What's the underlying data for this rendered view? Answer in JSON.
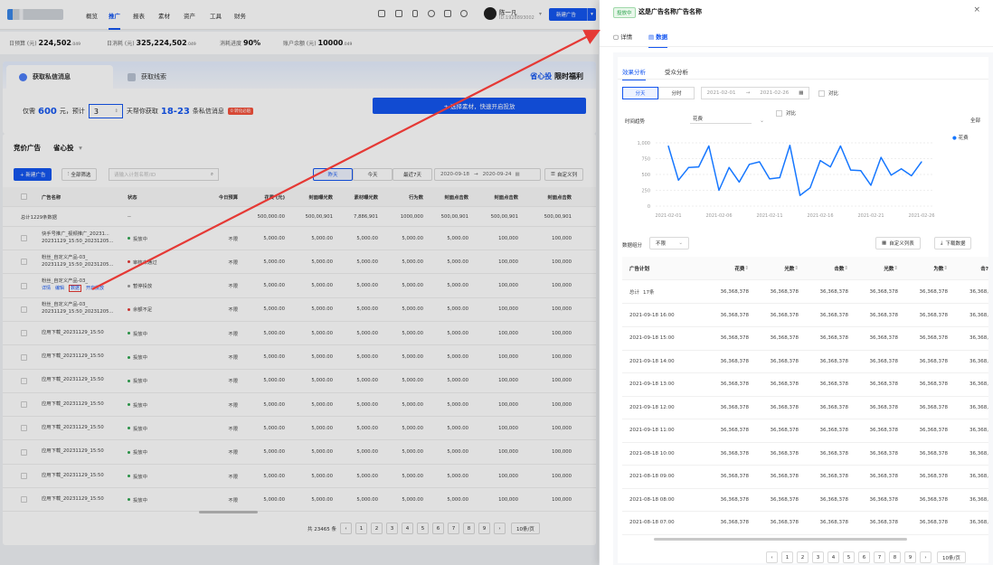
{
  "nav": {
    "items": [
      "概览",
      "推广",
      "报表",
      "素材",
      "资产",
      "工具",
      "财务"
    ],
    "active_index": 1,
    "user_name": "陈一凡",
    "user_id": "ID:1928893002",
    "new_ad_button": "新建广告"
  },
  "budget": {
    "daily_label": "日预算 (元)",
    "daily_value": "224,502",
    "daily_dec": ".049",
    "spend_label": "日消耗 (元)",
    "spend_value": "325,224,502",
    "spend_dec": ".049",
    "progress_label": "消耗进度",
    "progress_value": "90%",
    "balance_label": "账户余额 (元)",
    "balance_value": "10000",
    "balance_dec": ".049"
  },
  "promo": {
    "tab1": "获取私信消息",
    "tab2": "获取线索",
    "brand": "省心投",
    "brand_suffix": "限时福利",
    "line_prefix": "仅需",
    "price": "600",
    "line_mid": "元，预计",
    "days": "3",
    "line_mid2": "天帮你获取",
    "range": "18-23",
    "line_suffix": "条私信消息",
    "tag": "0 转化必赔",
    "cta": "+ 选择素材，快速开启投放"
  },
  "ads": {
    "title": "竞价广告",
    "mode": "省心投",
    "new_button": "+ 新建广告",
    "filter_button": "全部筛选",
    "search_placeholder": "请输入计划名称/ID",
    "seg": [
      "昨天",
      "今天",
      "最近7天"
    ],
    "seg_active": 0,
    "date_from": "2020-09-18",
    "date_to": "2020-09-24",
    "custom_cols": "自定义列",
    "columns": [
      "广告名称",
      "状态",
      "今日预算",
      "花费 (元)",
      "封面曝光数",
      "素材曝光数",
      "行为数",
      "封面点击数",
      "封面点击数",
      "封面点击数"
    ],
    "total_row": {
      "name": "总计1229条数据",
      "status": "--",
      "values": [
        "500,000.00",
        "500,00,901",
        "7,886,901",
        "1000,000",
        "500,00,901",
        "500,00,901",
        "500,00,901"
      ]
    },
    "rows": [
      {
        "name1": "快手号推广_视频推广_20231...",
        "name2": "20231129_15:50_20231205...",
        "status": "投放中",
        "status_color": "#2ea44f",
        "budget": "不限",
        "v": [
          "5,000.00",
          "5,000.00",
          "5,000.00",
          "5,000.00",
          "5,000.00",
          "100,000",
          "100,000"
        ]
      },
      {
        "name1": "粉丝_自定义产品-03_",
        "name2": "20231129_15:50_20231205...",
        "status": "审核未通过",
        "status_color": "#e53935",
        "budget": "不限",
        "v": [
          "5,000.00",
          "5,000.00",
          "5,000.00",
          "5,000.00",
          "5,000.00",
          "100,000",
          "100,000"
        ]
      },
      {
        "name1": "粉丝_自定义产品-03_",
        "name2": "",
        "status": "暂停投放",
        "status_color": "#999999",
        "budget": "不限",
        "v": [
          "5,000.00",
          "5,000.00",
          "5,000.00",
          "5,000.00",
          "5,000.00",
          "100,000",
          "100,000"
        ],
        "links": [
          "详情",
          "编辑",
          "数据",
          "开启投放"
        ]
      },
      {
        "name1": "粉丝_自定义产品-03_",
        "name2": "20231129_15:50_20231205...",
        "status": "余额不足",
        "status_color": "#e53935",
        "budget": "不限",
        "v": [
          "5,000.00",
          "5,000.00",
          "5,000.00",
          "5,000.00",
          "5,000.00",
          "100,000",
          "100,000"
        ]
      },
      {
        "name1": "应用下载_20231129_15:50",
        "name2": "",
        "status": "投放中",
        "status_color": "#2ea44f",
        "budget": "不限",
        "v": [
          "5,000.00",
          "5,000.00",
          "5,000.00",
          "5,000.00",
          "5,000.00",
          "100,000",
          "100,000"
        ]
      },
      {
        "name1": "应用下载_20231129_15:50",
        "name2": "",
        "status": "投放中",
        "status_color": "#2ea44f",
        "budget": "不限",
        "v": [
          "5,000.00",
          "5,000.00",
          "5,000.00",
          "5,000.00",
          "5,000.00",
          "100,000",
          "100,000"
        ]
      },
      {
        "name1": "应用下载_20231129_15:50",
        "name2": "",
        "status": "投放中",
        "status_color": "#2ea44f",
        "budget": "不限",
        "v": [
          "5,000.00",
          "5,000.00",
          "5,000.00",
          "5,000.00",
          "5,000.00",
          "100,000",
          "100,000"
        ]
      },
      {
        "name1": "应用下载_20231129_15:50",
        "name2": "",
        "status": "投放中",
        "status_color": "#2ea44f",
        "budget": "不限",
        "v": [
          "5,000.00",
          "5,000.00",
          "5,000.00",
          "5,000.00",
          "5,000.00",
          "100,000",
          "100,000"
        ]
      },
      {
        "name1": "应用下载_20231129_15:50",
        "name2": "",
        "status": "投放中",
        "status_color": "#2ea44f",
        "budget": "不限",
        "v": [
          "5,000.00",
          "5,000.00",
          "5,000.00",
          "5,000.00",
          "5,000.00",
          "100,000",
          "100,000"
        ]
      },
      {
        "name1": "应用下载_20231129_15:50",
        "name2": "",
        "status": "投放中",
        "status_color": "#2ea44f",
        "budget": "不限",
        "v": [
          "5,000.00",
          "5,000.00",
          "5,000.00",
          "5,000.00",
          "5,000.00",
          "100,000",
          "100,000"
        ]
      },
      {
        "name1": "应用下载_20231129_15:50",
        "name2": "",
        "status": "投放中",
        "status_color": "#2ea44f",
        "budget": "不限",
        "v": [
          "5,000.00",
          "5,000.00",
          "5,000.00",
          "5,000.00",
          "5,000.00",
          "100,000",
          "100,000"
        ]
      },
      {
        "name1": "应用下载_20231129_15:50",
        "name2": "",
        "status": "投放中",
        "status_color": "#2ea44f",
        "budget": "不限",
        "v": [
          "5,000.00",
          "5,000.00",
          "5,000.00",
          "5,000.00",
          "5,000.00",
          "100,000",
          "100,000"
        ]
      }
    ],
    "pager_total": "共 23465 条",
    "pages": [
      "1",
      "2",
      "3",
      "4",
      "5",
      "6",
      "7",
      "8",
      "9"
    ],
    "page_size": "10条/页"
  },
  "drawer": {
    "status": "投放中",
    "title": "这是广告名称广告名称",
    "close": "×",
    "tabs": [
      "详情",
      "数据"
    ],
    "tab_active": 1,
    "subtabs": [
      "效果分析",
      "受众分析"
    ],
    "seg": [
      "分天",
      "分时"
    ],
    "date_from": "2021-02-01",
    "date_to": "2021-02-26",
    "compare": "对比",
    "chart_label": "时间趋势",
    "metric_select": "花费",
    "chart_compare": "对比",
    "legend": "花费",
    "right_label": "全部",
    "group_label": "数据组分",
    "group_select": "不限",
    "custom_cols": "自定义列表",
    "download": "下载数据",
    "columns": [
      "广告计划",
      "花费",
      "光数",
      "击数",
      "光数",
      "为数",
      "击?"
    ],
    "total": {
      "label": "总计",
      "count": "17条",
      "values": [
        "36,368,378",
        "36,368,378",
        "36,368,378",
        "36,368,378",
        "36,368,378",
        "36,368,"
      ]
    },
    "rows": [
      {
        "time": "2021-09-18 16:00",
        "values": [
          "36,368,378",
          "36,368,378",
          "36,368,378",
          "36,368,378",
          "36,368,378",
          "36,368,"
        ]
      },
      {
        "time": "2021-09-18 15:00",
        "values": [
          "36,368,378",
          "36,368,378",
          "36,368,378",
          "36,368,378",
          "36,368,378",
          "36,368,"
        ]
      },
      {
        "time": "2021-09-18 14:00",
        "values": [
          "36,368,378",
          "36,368,378",
          "36,368,378",
          "36,368,378",
          "36,368,378",
          "36,368,"
        ]
      },
      {
        "time": "2021-09-18 13:00",
        "values": [
          "36,368,378",
          "36,368,378",
          "36,368,378",
          "36,368,378",
          "36,368,378",
          "36,368,"
        ]
      },
      {
        "time": "2021-09-18 12:00",
        "values": [
          "36,368,378",
          "36,368,378",
          "36,368,378",
          "36,368,378",
          "36,368,378",
          "36,368,"
        ]
      },
      {
        "time": "2021-09-18 11:00",
        "values": [
          "36,368,378",
          "36,368,378",
          "36,368,378",
          "36,368,378",
          "36,368,378",
          "36,368,"
        ]
      },
      {
        "time": "2021-08-18 10:00",
        "values": [
          "36,368,378",
          "36,368,378",
          "36,368,378",
          "36,368,378",
          "36,368,378",
          "36,368,"
        ]
      },
      {
        "time": "2021-08-18 09:00",
        "values": [
          "36,368,378",
          "36,368,378",
          "36,368,378",
          "36,368,378",
          "36,368,378",
          "36,368,"
        ]
      },
      {
        "time": "2021-08-18 08:00",
        "values": [
          "36,368,378",
          "36,368,378",
          "36,368,378",
          "36,368,378",
          "36,368,378",
          "36,368,"
        ]
      },
      {
        "time": "2021-08-18 07:00",
        "values": [
          "36,368,378",
          "36,368,378",
          "36,368,378",
          "36,368,378",
          "36,368,378",
          "36,368,"
        ]
      }
    ],
    "pages": [
      "1",
      "2",
      "3",
      "4",
      "5",
      "6",
      "7",
      "8",
      "9"
    ],
    "page_size": "10条/页"
  },
  "chart_data": {
    "type": "line",
    "title": "",
    "xlabel": "",
    "ylabel": "",
    "yticks": [
      "0",
      "250",
      "500",
      "750",
      "1,000"
    ],
    "ylim": [
      0,
      1000
    ],
    "xticks": [
      "2021-02-01",
      "2021-02-06",
      "2021-02-11",
      "2021-02-16",
      "2021-02-21",
      "2021-02-26"
    ],
    "series": [
      {
        "name": "花费",
        "color": "#1677ff",
        "values": [
          950,
          410,
          610,
          620,
          950,
          250,
          610,
          380,
          660,
          700,
          430,
          450,
          960,
          170,
          290,
          720,
          620,
          950,
          570,
          560,
          330,
          770,
          490,
          590,
          480,
          700
        ]
      }
    ],
    "grid": true,
    "legend_position": "top-right"
  },
  "colors": {
    "accent": "#1456f0",
    "success": "#2ea44f",
    "danger": "#e53935",
    "annotation": "#e53935"
  }
}
